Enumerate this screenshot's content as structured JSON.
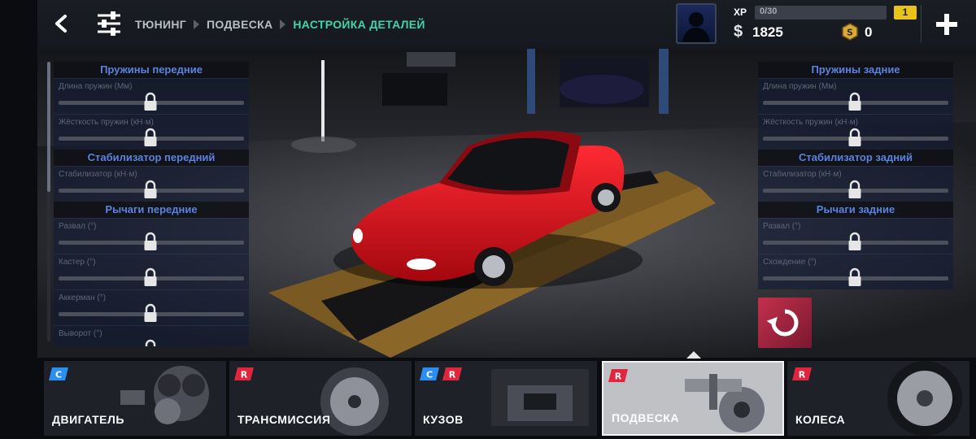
{
  "header": {
    "breadcrumbs": [
      "ТЮНИНГ",
      "ПОДВЕСКА",
      "НАСТРОЙКА ДЕТАЛЕЙ"
    ],
    "back_icon": "chevron-left-icon",
    "tune_icon": "sliders-icon",
    "add_icon": "plus-icon"
  },
  "profile": {
    "xp_label": "XP",
    "xp_text": "0/30",
    "xp_progress": 0,
    "level": "1",
    "money_symbol": "$",
    "money": "1825",
    "gold": "0"
  },
  "left_panel": {
    "sections": [
      {
        "title": "Пружины передние",
        "rows": [
          "Длина пружин (Мм)",
          "Жёсткость пружин (кН·м)"
        ]
      },
      {
        "title": "Стабилизатор передний",
        "rows": [
          "Стабилизатор (кН·м)"
        ]
      },
      {
        "title": "Рычаги передние",
        "rows": [
          "Развал (°)",
          "Кастер (°)",
          "Аккерман (°)",
          "Выворот (°)"
        ]
      }
    ]
  },
  "right_panel": {
    "sections": [
      {
        "title": "Пружины задние",
        "rows": [
          "Длина пружин (Мм)",
          "Жёсткость пружин (кН·м)"
        ]
      },
      {
        "title": "Стабилизатор задний",
        "rows": [
          "Стабилизатор (кН·м)"
        ]
      },
      {
        "title": "Рычаги задние",
        "rows": [
          "Развал (°)",
          "Схождение (°)"
        ]
      }
    ]
  },
  "categories": [
    {
      "name": "ДВИГАТЕЛЬ",
      "badges": [
        "C"
      ]
    },
    {
      "name": "ТРАНСМИССИЯ",
      "badges": [
        "R"
      ]
    },
    {
      "name": "КУЗОВ",
      "badges": [
        "C",
        "R"
      ]
    },
    {
      "name": "ПОДВЕСКА",
      "badges": [
        "R"
      ],
      "selected": true
    },
    {
      "name": "КОЛЕСА",
      "badges": [
        "R"
      ]
    }
  ],
  "colors": {
    "accent_green": "#3fd6a6",
    "section_title_blue": "#5b82e0",
    "level_badge": "#e9c21a",
    "reset_red": "#c3304c",
    "car_red": "#d8121c"
  }
}
